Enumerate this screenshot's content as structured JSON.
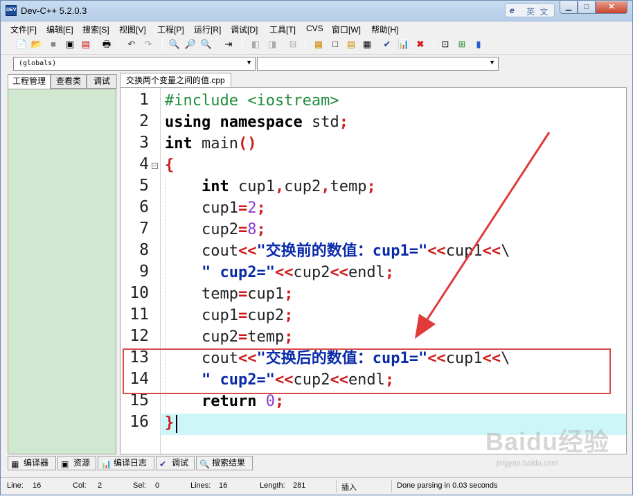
{
  "window": {
    "title": "Dev-C++ 5.2.0.3",
    "ime_label": "英 文",
    "ime_logo": "e"
  },
  "menu": [
    "文件[F]",
    "编辑[E]",
    "搜索[S]",
    "视图[V]",
    "工程[P]",
    "运行[R]",
    "调试[D]",
    "工具[T]",
    "CVS",
    "窗口[W]",
    "帮助[H]"
  ],
  "dropdowns": {
    "scope": "(globals)",
    "function": ""
  },
  "left_tabs": [
    "工程管理",
    "查看类",
    "调试"
  ],
  "editor": {
    "tab_label": "交换两个变量之间的值.cpp",
    "line_numbers": [
      "1",
      "2",
      "3",
      "4",
      "5",
      "6",
      "7",
      "8",
      "9",
      "10",
      "11",
      "12",
      "13",
      "14",
      "15",
      "16"
    ],
    "fold_glyph": "−"
  },
  "bottom_tabs": [
    "编译器",
    "资源",
    "编译日志",
    "调试",
    "搜索结果"
  ],
  "status": {
    "line_label": "Line:",
    "line": "16",
    "col_label": "Col:",
    "col": "2",
    "sel_label": "Sel:",
    "sel": "0",
    "lines_label": "Lines:",
    "lines": "16",
    "length_label": "Length:",
    "length": "281",
    "mode": "插入",
    "message": "Done parsing in 0.03 seconds"
  },
  "watermark": {
    "brand": "Baidu经验",
    "url": "jingyan.baidu.com"
  },
  "colors": {
    "keyword": "#000000",
    "preprocessor": "#1e8c3a",
    "operator": "#cc1a1a",
    "number": "#8a3bd1",
    "string": "#0a2ba8",
    "highlight_box": "#d84a4a",
    "current_line": "#ccf6f8",
    "project_panel": "#cfe8cf"
  }
}
